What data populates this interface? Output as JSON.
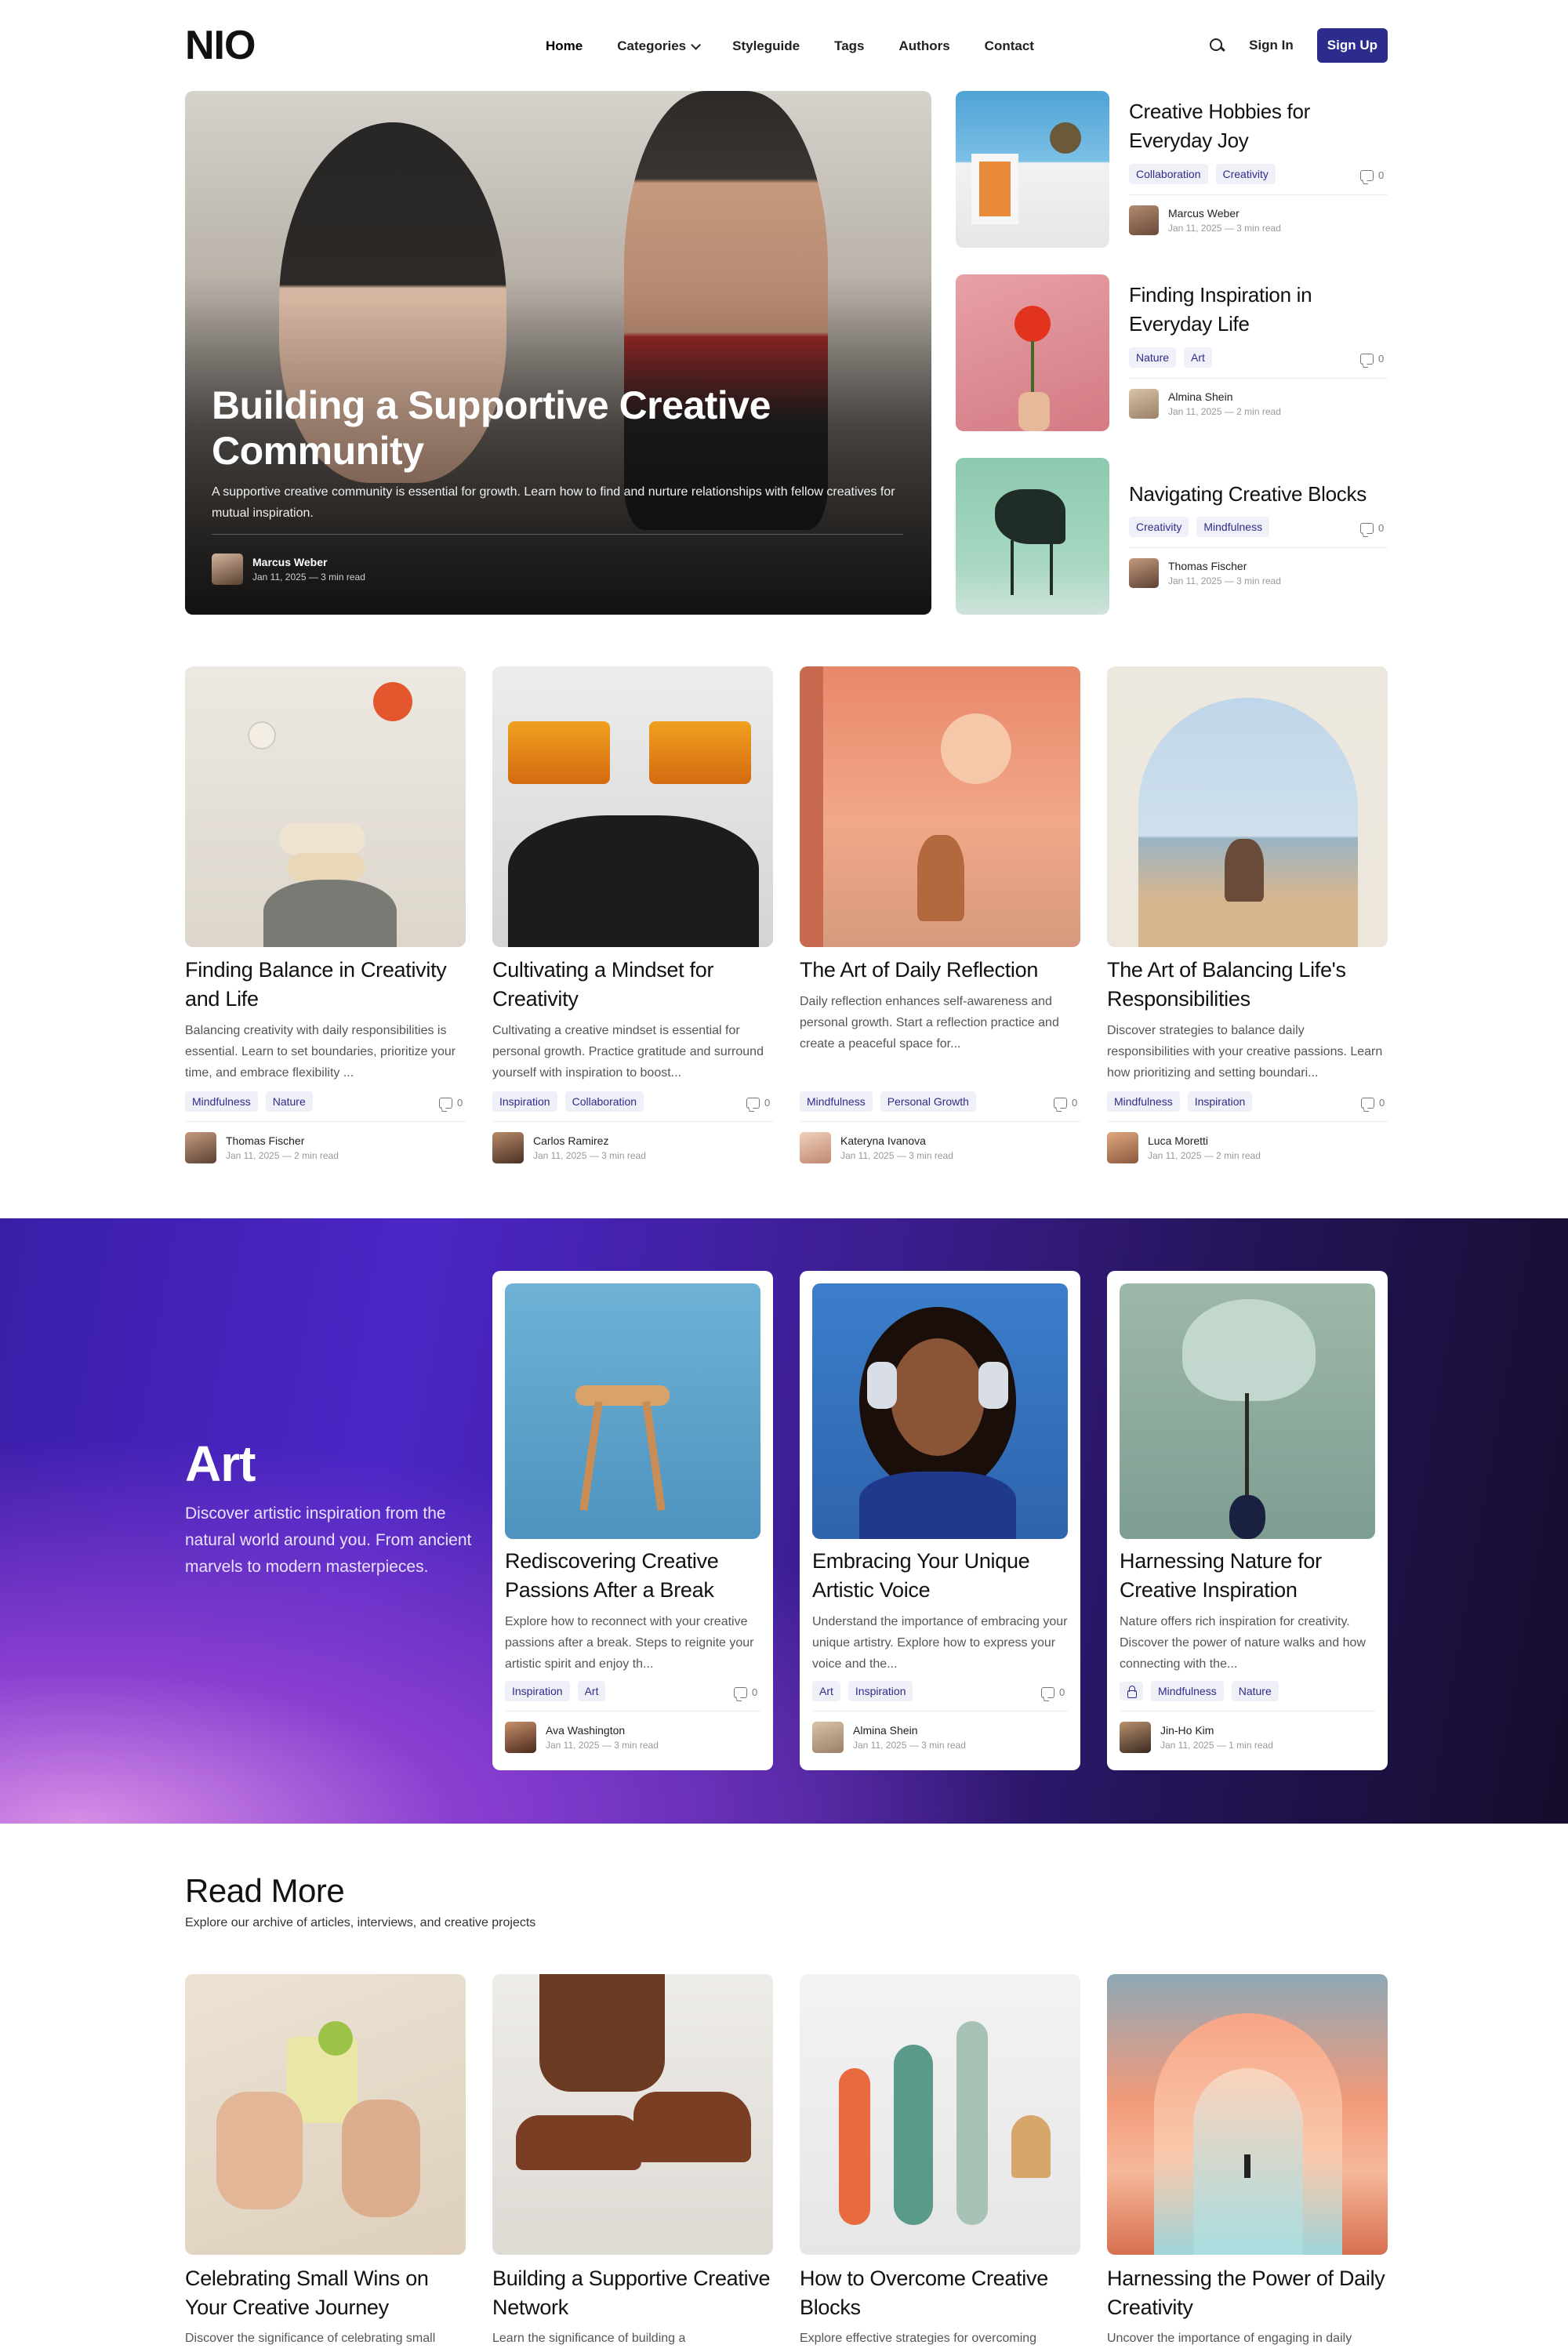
{
  "brand": {
    "logo": "NIO"
  },
  "nav": {
    "items": [
      {
        "label": "Home"
      },
      {
        "label": "Categories"
      },
      {
        "label": "Styleguide"
      },
      {
        "label": "Tags"
      },
      {
        "label": "Authors"
      },
      {
        "label": "Contact"
      }
    ],
    "signin_label": "Sign In",
    "signup_label": "Sign Up"
  },
  "hero": {
    "title": "Building a Supportive Creative Community",
    "description": "A supportive creative community is essential for growth. Learn how to find and nurture relationships with fellow creatives for mutual inspiration.",
    "author": "Marcus Weber",
    "meta": "Jan 11, 2025 — 3 min read"
  },
  "side_posts": [
    {
      "title": "Creative Hobbies for Everyday Joy",
      "tags": [
        "Collaboration",
        "Creativity"
      ],
      "comments": "0",
      "author": "Marcus Weber",
      "meta": "Jan 11, 2025 — 3 min read"
    },
    {
      "title": "Finding Inspiration in Everyday Life",
      "tags": [
        "Nature",
        "Art"
      ],
      "comments": "0",
      "author": "Almina Shein",
      "meta": "Jan 11, 2025 — 2 min read"
    },
    {
      "title": "Navigating Creative Blocks",
      "tags": [
        "Creativity",
        "Mindfulness"
      ],
      "comments": "0",
      "author": "Thomas Fischer",
      "meta": "Jan 11, 2025 — 3 min read"
    }
  ],
  "grid_posts": [
    {
      "title": "Finding Balance in Creativity and Life",
      "desc": "Balancing creativity with daily responsibilities is essential. Learn to set boundaries, prioritize your time, and embrace flexibility ...",
      "tags": [
        "Mindfulness",
        "Nature"
      ],
      "comments": "0",
      "author": "Thomas Fischer",
      "meta": "Jan 11, 2025 — 2 min read"
    },
    {
      "title": "Cultivating a Mindset for Creativity",
      "desc": "Cultivating a creative mindset is essential for personal growth. Practice gratitude and surround yourself with inspiration to boost...",
      "tags": [
        "Inspiration",
        "Collaboration"
      ],
      "comments": "0",
      "author": "Carlos Ramirez",
      "meta": "Jan 11, 2025 — 3 min read"
    },
    {
      "title": "The Art of Daily Reflection",
      "desc": "Daily reflection enhances self-awareness and personal growth. Start a reflection practice and create a peaceful space for...",
      "tags": [
        "Mindfulness",
        "Personal Growth"
      ],
      "comments": "0",
      "author": "Kateryna Ivanova",
      "meta": "Jan 11, 2025 — 3 min read"
    },
    {
      "title": "The Art of Balancing Life's Responsibilities",
      "desc": "Discover strategies to balance daily responsibilities with your creative passions. Learn how prioritizing and setting boundari...",
      "tags": [
        "Mindfulness",
        "Inspiration"
      ],
      "comments": "0",
      "author": "Luca Moretti",
      "meta": "Jan 11, 2025 — 2 min read"
    }
  ],
  "art_section": {
    "title": "Art",
    "description": "Discover artistic inspiration from the natural world around you. From ancient marvels to modern masterpieces.",
    "posts": [
      {
        "title": "Rediscovering Creative Passions After a Break",
        "desc": "Explore how to reconnect with your creative passions after a break. Steps to reignite your artistic spirit and enjoy th...",
        "tags": [
          "Inspiration",
          "Art"
        ],
        "comments": "0",
        "author": "Ava Washington",
        "meta": "Jan 11, 2025 — 3 min read"
      },
      {
        "title": "Embracing Your Unique Artistic Voice",
        "desc": "Understand the importance of embracing your unique artistry. Explore how to express your voice and the...",
        "tags": [
          "Art",
          "Inspiration"
        ],
        "comments": "0",
        "author": "Almina Shein",
        "meta": "Jan 11, 2025 — 3 min read"
      },
      {
        "title": "Harnessing Nature for Creative Inspiration",
        "desc": "Nature offers rich inspiration for creativity. Discover the power of nature walks and how connecting with the...",
        "tags": [
          "Mindfulness",
          "Nature"
        ],
        "author": "Jin-Ho Kim",
        "meta": "Jan 11, 2025 — 1 min read"
      }
    ]
  },
  "read_more": {
    "title": "Read More",
    "subtitle": "Explore our archive of articles, interviews, and creative projects",
    "posts": [
      {
        "title": "Celebrating Small Wins on Your Creative Journey",
        "desc": "Discover the significance of celebrating small"
      },
      {
        "title": "Building a Supportive Creative Network",
        "desc": "Learn the significance of building a"
      },
      {
        "title": "How to Overcome Creative Blocks",
        "desc": "Explore effective strategies for overcoming"
      },
      {
        "title": "Harnessing the Power of Daily Creativity",
        "desc": "Uncover the importance of engaging in daily"
      }
    ]
  },
  "colors": {
    "accent": "#2c2c8c",
    "tag_bg": "#f0f1f8",
    "band_start": "#3a1ea8",
    "band_end": "#160c2c"
  }
}
